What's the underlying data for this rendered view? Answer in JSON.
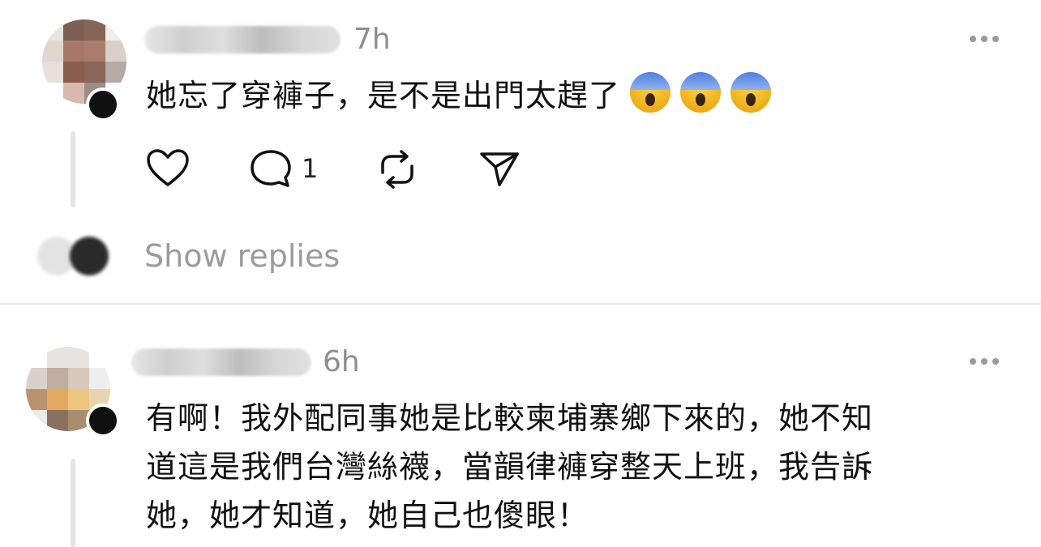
{
  "comments": [
    {
      "time": "7h",
      "text": "她忘了穿褲子，是不是出門太趕了",
      "emojis": [
        "face-screaming-in-fear",
        "face-screaming-in-fear",
        "face-screaming-in-fear"
      ],
      "reply_count": "1"
    },
    {
      "time": "6h",
      "lines": [
        "有啊！我外配同事她是比較柬埔寨鄉下來的，她不知",
        "道這是我們台灣絲襪，當韻律褲穿整天上班，我告訴",
        "她，她才知道，她自己也傻眼！"
      ]
    }
  ],
  "show_replies_label": "Show replies",
  "colors": {
    "text": "#111111",
    "muted": "#8e8e8e",
    "divider": "#e6e6e6"
  }
}
